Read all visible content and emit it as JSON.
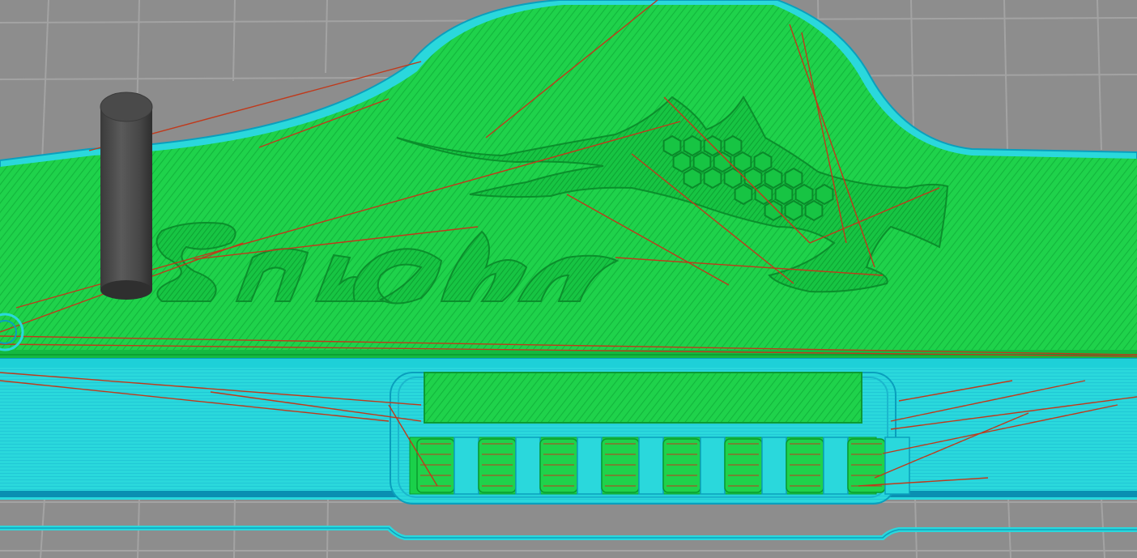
{
  "view": {
    "type": "slicer-3d-preview",
    "visible_text": ""
  },
  "colors": {
    "build_plate": "#8d8d8d",
    "grid_line": "#a4a4a4",
    "top_solid_infill": "#1fd24b",
    "top_solid_infill_dark": "#0fa832",
    "perimeter": "#2ad8dc",
    "perimeter_dark": "#0a9fbd",
    "travel_move": "#c0391b",
    "wipe_tower": "#4a4a4a"
  },
  "objects": [
    {
      "name": "main-plate",
      "feature": "top-solid-infill"
    },
    {
      "name": "front-ledge",
      "feature": "perimeter"
    },
    {
      "name": "slot-block",
      "feature": "perimeter"
    },
    {
      "name": "wipe-tower",
      "feature": "cylinder"
    }
  ],
  "engraving": {
    "text": "",
    "slot_count": 8
  },
  "icons": [
    "dragon-relief-icon"
  ]
}
